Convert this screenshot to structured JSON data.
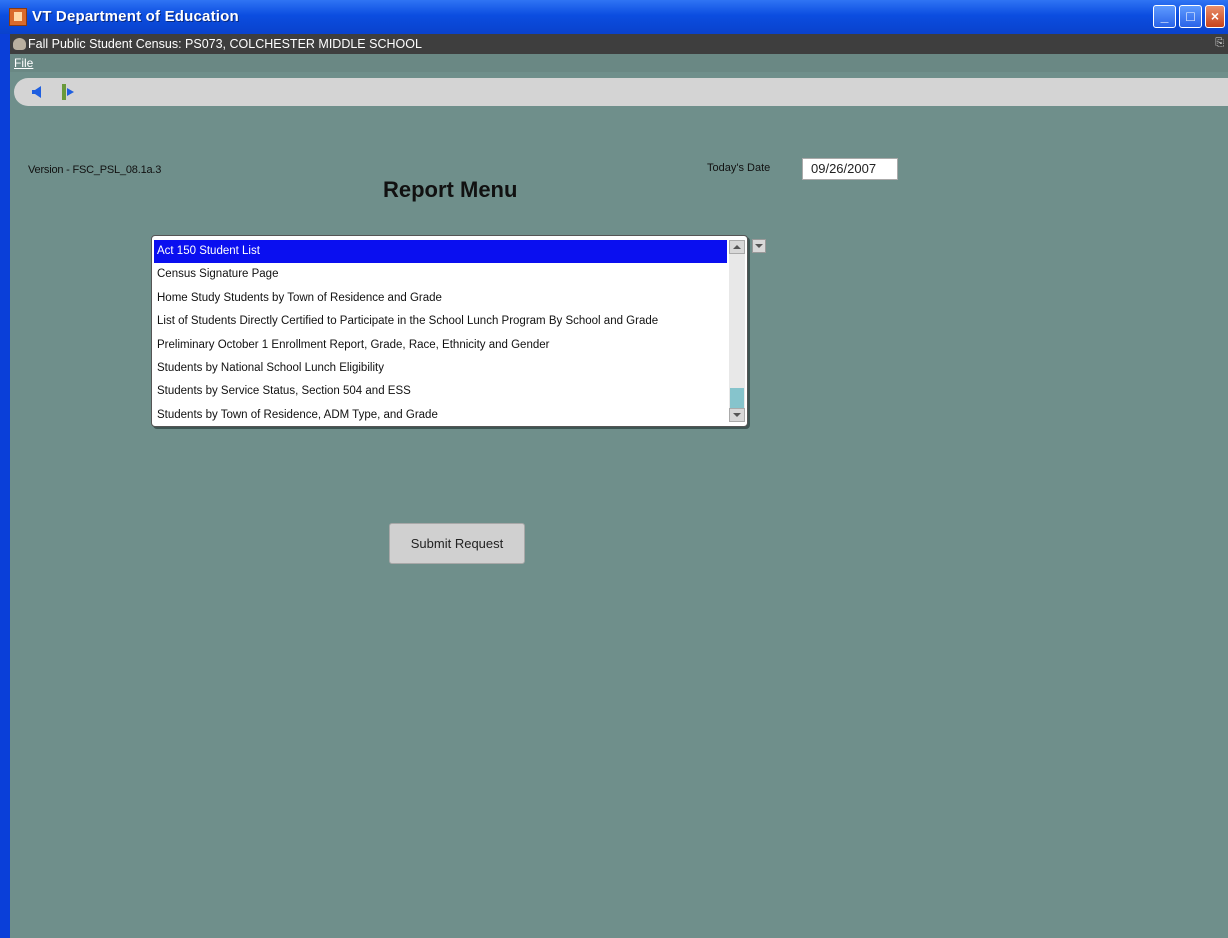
{
  "window": {
    "title": "VT Department of Education",
    "buttons": {
      "minimize": "_",
      "maximize": "□",
      "close": "×"
    }
  },
  "inner_window": {
    "title": "Fall Public Student Census:  PS073, COLCHESTER MIDDLE SCHOOL",
    "restore": "⎘"
  },
  "menu": {
    "file": "File"
  },
  "toolbar": {
    "back_icon": "back-arrow-icon",
    "forward_icon": "forward-exit-icon"
  },
  "page": {
    "version": "Version - FSC_PSL_08.1a.3",
    "date_label": "Today's Date",
    "date_value": "09/26/2007",
    "title": "Report Menu"
  },
  "report_list": {
    "items": [
      "Act 150 Student List",
      "Census Signature Page",
      "Home Study Students by Town of Residence and Grade",
      "List of Students Directly Certified to Participate in the School Lunch Program By School and Grade",
      "Preliminary October 1 Enrollment Report, Grade, Race, Ethnicity and Gender",
      "Students by National School Lunch Eligibility",
      "Students by Service Status, Section 504 and ESS",
      "Students by Town of Residence, ADM Type, and Grade"
    ],
    "selected_index": 0
  },
  "submit_label": "Submit Request",
  "colors": {
    "background": "#6f8f8b",
    "titlebar": "#0b4de0",
    "selection": "#0a0ff0"
  }
}
